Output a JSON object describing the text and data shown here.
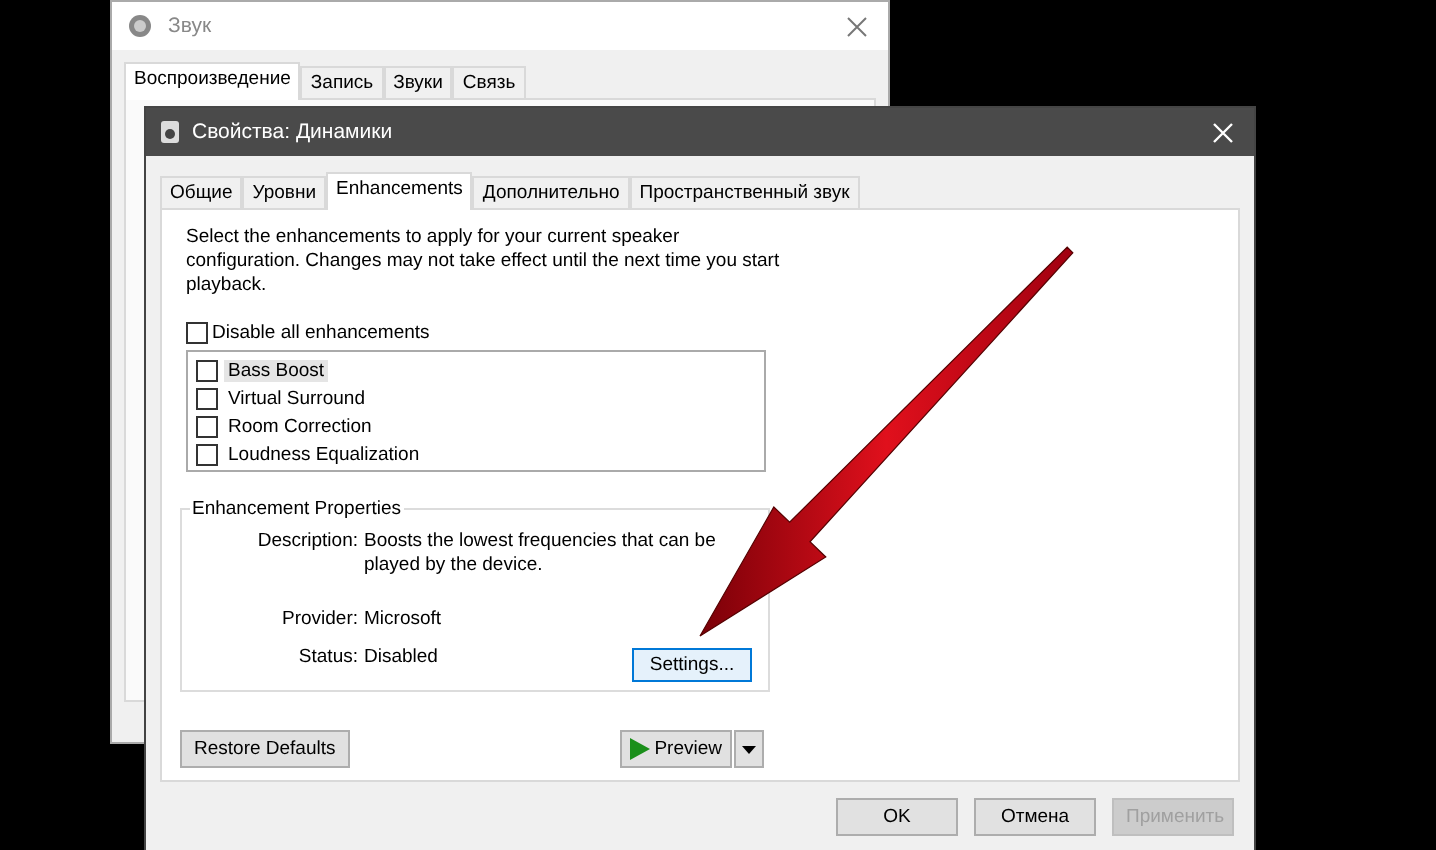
{
  "back_window": {
    "title": "Звук",
    "tabs": [
      {
        "label": "Воспроизведение",
        "selected": true
      },
      {
        "label": "Запись",
        "selected": false
      },
      {
        "label": "Звуки",
        "selected": false
      },
      {
        "label": "Связь",
        "selected": false
      }
    ]
  },
  "window": {
    "title": "Свойства: Динамики",
    "tabs": [
      {
        "label": "Общие",
        "selected": false
      },
      {
        "label": "Уровни",
        "selected": false
      },
      {
        "label": "Enhancements",
        "selected": true
      },
      {
        "label": "Дополнительно",
        "selected": false
      },
      {
        "label": "Пространственный звук",
        "selected": false
      }
    ]
  },
  "intro": "Select the enhancements to apply for your current speaker configuration. Changes may not take effect until the next time you start playback.",
  "disable_all": {
    "label": "Disable all enhancements",
    "checked": false
  },
  "enhancements": [
    {
      "label": "Bass Boost",
      "checked": false,
      "selected": true
    },
    {
      "label": "Virtual Surround",
      "checked": false,
      "selected": false
    },
    {
      "label": "Room Correction",
      "checked": false,
      "selected": false
    },
    {
      "label": "Loudness Equalization",
      "checked": false,
      "selected": false
    }
  ],
  "properties": {
    "title": "Enhancement Properties",
    "rows": [
      {
        "label": "Description:",
        "value": "Boosts the lowest frequencies that can be played by the device."
      },
      {
        "label": "Provider:",
        "value": "Microsoft"
      },
      {
        "label": "Status:",
        "value": "Disabled"
      }
    ],
    "settings_button": "Settings..."
  },
  "restore_button": "Restore Defaults",
  "preview_button": "Preview",
  "buttons": [
    {
      "label": "OK",
      "disabled": false
    },
    {
      "label": "Отмена",
      "disabled": false
    },
    {
      "label": "Применить",
      "disabled": true
    }
  ]
}
